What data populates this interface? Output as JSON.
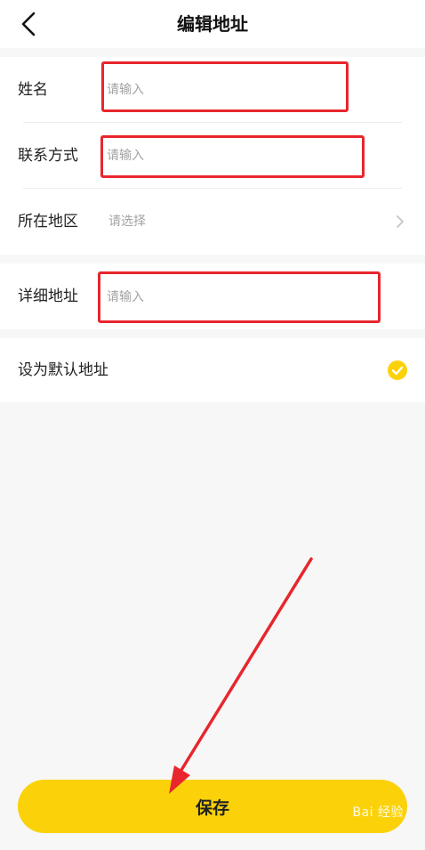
{
  "header": {
    "title": "编辑地址"
  },
  "form": {
    "name": {
      "label": "姓名",
      "placeholder": "请输入"
    },
    "contact": {
      "label": "联系方式",
      "placeholder": "请输入"
    },
    "region": {
      "label": "所在地区",
      "value": "请选择"
    },
    "address": {
      "label": "详细地址",
      "placeholder": "请输入"
    },
    "default": {
      "label": "设为默认地址",
      "checked": true
    }
  },
  "save_label": "保存",
  "watermark": "Bai 经验",
  "colors": {
    "accent": "#fbd20a",
    "highlight": "#e8262d",
    "background": "#f7f7f7"
  },
  "icons": {
    "back": "back-arrow-icon",
    "chevron": "chevron-right-icon",
    "check": "check-circle-icon"
  }
}
